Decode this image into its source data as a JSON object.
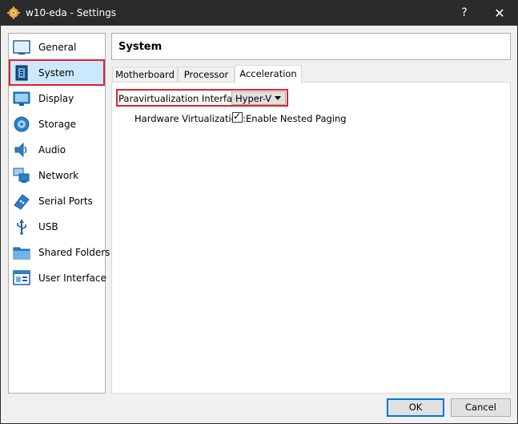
{
  "window": {
    "title": "w10-eda - Settings",
    "help_label": "?",
    "close_label": "✕"
  },
  "sidebar": {
    "items": [
      {
        "label": "General",
        "icon": "general-icon"
      },
      {
        "label": "System",
        "icon": "system-icon",
        "selected": true
      },
      {
        "label": "Display",
        "icon": "display-icon"
      },
      {
        "label": "Storage",
        "icon": "storage-icon"
      },
      {
        "label": "Audio",
        "icon": "audio-icon"
      },
      {
        "label": "Network",
        "icon": "network-icon"
      },
      {
        "label": "Serial Ports",
        "icon": "serial-ports-icon"
      },
      {
        "label": "USB",
        "icon": "usb-icon"
      },
      {
        "label": "Shared Folders",
        "icon": "shared-folders-icon"
      },
      {
        "label": "User Interface",
        "icon": "user-interface-icon"
      }
    ]
  },
  "page": {
    "title": "System"
  },
  "tabs": [
    {
      "label": "Motherboard"
    },
    {
      "label": "Processor"
    },
    {
      "label": "Acceleration",
      "active": true
    }
  ],
  "acceleration": {
    "paravirt_label": "Paravirtualization Interface:",
    "paravirt_value": "Hyper-V",
    "hw_label": "Hardware Virtualization:",
    "nested_paging_label": "Enable Nested Paging",
    "nested_paging_checked": true
  },
  "buttons": {
    "ok": "OK",
    "cancel": "Cancel"
  },
  "colors": {
    "highlight": "#e0232e",
    "selection": "#cce8ff",
    "titlebar": "#2b2b2b"
  }
}
